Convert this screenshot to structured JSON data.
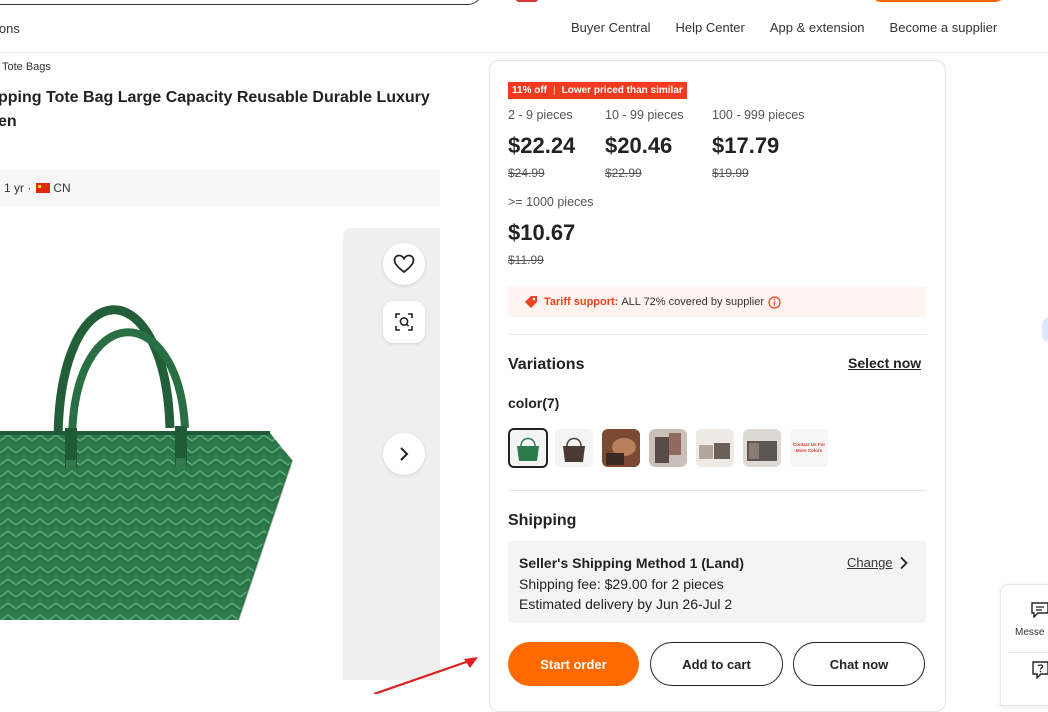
{
  "nav": {
    "left_label": "ions",
    "links": [
      "Buyer Central",
      "Help Center",
      "App & extension",
      "Become a supplier"
    ]
  },
  "breadcrumb": "Tote Bags",
  "product": {
    "title_line1": "pping Tote Bag Large Capacity Reusable Durable Luxury",
    "title_line2": "en",
    "supplier_years": "1 yr ·",
    "supplier_country": "CN"
  },
  "pricing": {
    "discount_tag": "11% off",
    "tag_note": "Lower priced than similar",
    "tiers": [
      {
        "range": "2 - 9 pieces",
        "price": "$22.24",
        "old_price": "$24.99"
      },
      {
        "range": "10 - 99 pieces",
        "price": "$20.46",
        "old_price": "$22.99"
      },
      {
        "range": "100 - 999 pieces",
        "price": "$17.79",
        "old_price": "$19.99"
      },
      {
        "range": ">= 1000 pieces",
        "price": "$10.67",
        "old_price": "$11.99"
      }
    ]
  },
  "tariff": {
    "label": "Tariff support:",
    "text": "ALL 72% covered by supplier"
  },
  "variations": {
    "heading": "Variations",
    "select_now": "Select now",
    "color_label": "color(7)",
    "contact_swatch_text": "Contact Us For More Colors"
  },
  "shipping": {
    "heading": "Shipping",
    "method": "Seller's Shipping Method 1 (Land)",
    "change": "Change",
    "fee": "Shipping fee: $29.00 for 2 pieces",
    "delivery": "Estimated delivery by Jun 26-Jul 2"
  },
  "actions": {
    "start_order": "Start order",
    "add_to_cart": "Add to cart",
    "chat_now": "Chat now"
  },
  "float": {
    "messenger": "Messe"
  },
  "colors": {
    "accent": "#ff6a00",
    "tag_red": "#f33a1f",
    "bag_green": "#2c7a4a",
    "annotation_arrow": "#e02020"
  }
}
